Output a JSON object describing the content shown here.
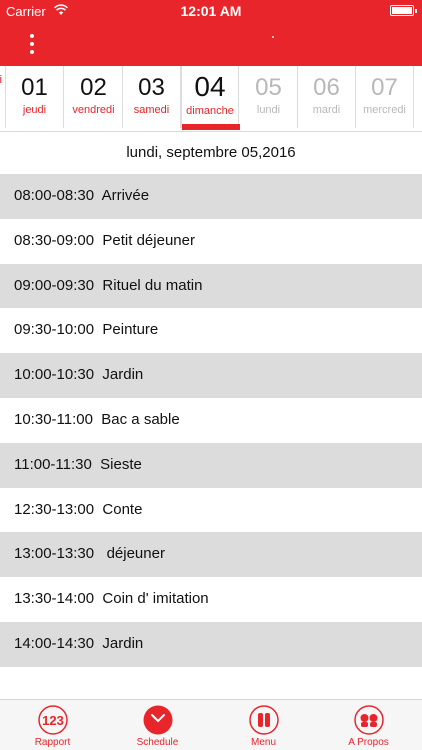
{
  "status_bar": {
    "carrier": "Carrier",
    "time": "12:01 AM"
  },
  "day_strip": {
    "days": [
      {
        "num": "",
        "name": "i"
      },
      {
        "num": "01",
        "name": "jeudi"
      },
      {
        "num": "02",
        "name": "vendredi"
      },
      {
        "num": "03",
        "name": "samedi"
      },
      {
        "num": "04",
        "name": "dimanche"
      },
      {
        "num": "05",
        "name": "lundi"
      },
      {
        "num": "06",
        "name": "mardi"
      },
      {
        "num": "07",
        "name": "mercredi"
      }
    ],
    "selected_index": 4
  },
  "date_header": "lundi, septembre 05,2016",
  "schedule": [
    {
      "text": "08:00-08:30  Arrivée"
    },
    {
      "text": "08:30-09:00  Petit déjeuner"
    },
    {
      "text": "09:00-09:30  Rituel du matin"
    },
    {
      "text": "09:30-10:00  Peinture"
    },
    {
      "text": "10:00-10:30  Jardin"
    },
    {
      "text": "10:30-11:00  Bac a sable"
    },
    {
      "text": "11:00-11:30  Sieste"
    },
    {
      "text": "12:30-13:00  Conte"
    },
    {
      "text": "13:00-13:30   déjeuner"
    },
    {
      "text": "13:30-14:00  Coin d' imitation"
    },
    {
      "text": "14:00-14:30  Jardin"
    }
  ],
  "tabs": [
    {
      "label": "Rapport",
      "icon": "numbers-123-icon"
    },
    {
      "label": "Schedule",
      "icon": "clock-icon"
    },
    {
      "label": "Menu",
      "icon": "fork-knife-icon"
    },
    {
      "label": "A Propos",
      "icon": "people-icon"
    }
  ],
  "colors": {
    "accent": "#e8252a",
    "shaded_row": "#dcdcdc",
    "future_day": "#b8b8b8"
  }
}
